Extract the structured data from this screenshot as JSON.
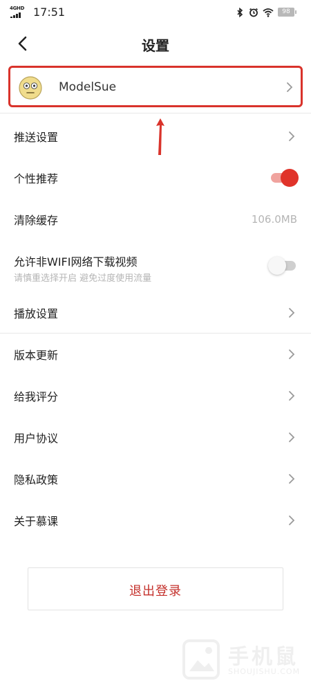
{
  "status_bar": {
    "network": "4GHD",
    "time": "17:51",
    "battery": "98",
    "icons": [
      "bluetooth-icon",
      "alarm-icon",
      "wifi-icon",
      "battery-icon"
    ]
  },
  "header": {
    "title": "设置",
    "back_icon": "chevron-left-icon"
  },
  "profile": {
    "name": "ModelSue",
    "avatar_icon": "smiley-avatar-icon"
  },
  "settings": {
    "push": {
      "label": "推送设置"
    },
    "personal": {
      "label": "个性推荐",
      "enabled": true
    },
    "cache": {
      "label": "清除缓存",
      "value": "106.0MB"
    },
    "wifi": {
      "label": "允许非WIFI网络下载视频",
      "sub": "请慎重选择开启 避免过度使用流量",
      "enabled": false
    },
    "playback": {
      "label": "播放设置"
    },
    "update": {
      "label": "版本更新"
    },
    "rate": {
      "label": "给我评分"
    },
    "agreement": {
      "label": "用户协议"
    },
    "privacy": {
      "label": "隐私政策"
    },
    "about": {
      "label": "关于慕课"
    }
  },
  "logout": {
    "label": "退出登录"
  },
  "watermark": {
    "text": "手机鼠",
    "sub": "SHOUJISHU.COM"
  },
  "colors": {
    "accent": "#e0332a",
    "highlight_border": "#d9332b",
    "logout_text": "#c4302b",
    "secondary_text": "#b5b5b5"
  }
}
